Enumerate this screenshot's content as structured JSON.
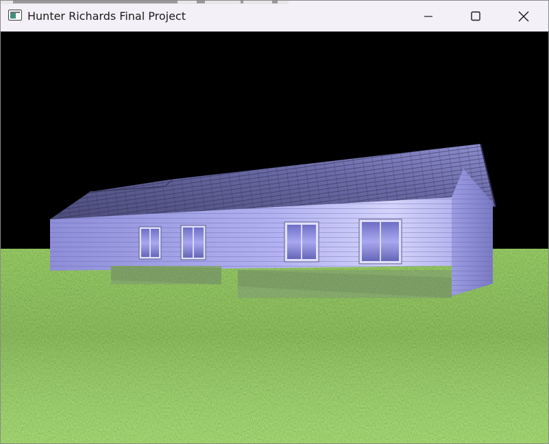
{
  "window": {
    "title": "Hunter Richards Final Project",
    "controls": {
      "minimize_icon": "minimize-icon",
      "maximize_icon": "maximize-icon",
      "close_icon": "close-icon"
    }
  },
  "scene": {
    "background_color": "#000000",
    "grass_color": "#5f8f2f",
    "wall_color": "#9c9ce6",
    "roof_color": "#5a5a8e",
    "hedge_color": "#2f4a25",
    "window_color": "#8c8ce0"
  }
}
